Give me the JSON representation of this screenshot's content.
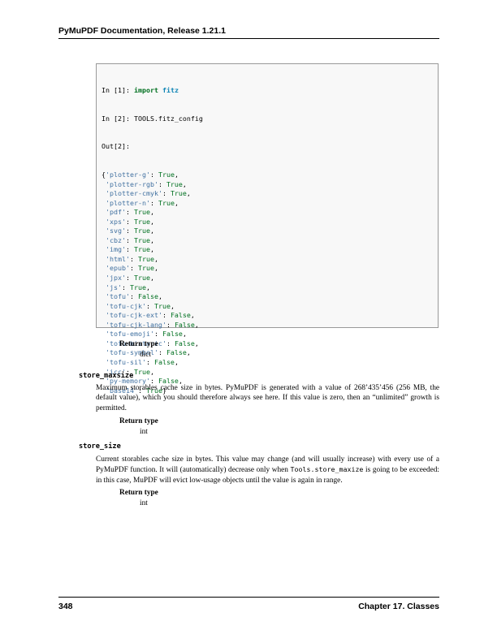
{
  "header": {
    "title": "PyMuPDF Documentation, Release 1.21.1"
  },
  "code": {
    "line1_prompt": "In [1]: ",
    "line1_kw": "import",
    "line1_space": " ",
    "line1_mod": "fitz",
    "line2": "In [2]: TOOLS.fitz_config",
    "line3": "Out[2]:",
    "entries": [
      {
        "key": "'plotter-g'",
        "value": "True"
      },
      {
        "key": "'plotter-rgb'",
        "value": "True"
      },
      {
        "key": "'plotter-cmyk'",
        "value": "True"
      },
      {
        "key": "'plotter-n'",
        "value": "True"
      },
      {
        "key": "'pdf'",
        "value": "True"
      },
      {
        "key": "'xps'",
        "value": "True"
      },
      {
        "key": "'svg'",
        "value": "True"
      },
      {
        "key": "'cbz'",
        "value": "True"
      },
      {
        "key": "'img'",
        "value": "True"
      },
      {
        "key": "'html'",
        "value": "True"
      },
      {
        "key": "'epub'",
        "value": "True"
      },
      {
        "key": "'jpx'",
        "value": "True"
      },
      {
        "key": "'js'",
        "value": "True"
      },
      {
        "key": "'tofu'",
        "value": "False"
      },
      {
        "key": "'tofu-cjk'",
        "value": "True"
      },
      {
        "key": "'tofu-cjk-ext'",
        "value": "False"
      },
      {
        "key": "'tofu-cjk-lang'",
        "value": "False"
      },
      {
        "key": "'tofu-emoji'",
        "value": "False"
      },
      {
        "key": "'tofu-historic'",
        "value": "False"
      },
      {
        "key": "'tofu-symbol'",
        "value": "False"
      },
      {
        "key": "'tofu-sil'",
        "value": "False"
      },
      {
        "key": "'icc'",
        "value": "True"
      },
      {
        "key": "'py-memory'",
        "value": "False"
      },
      {
        "key": "'base14'",
        "value": "True"
      }
    ]
  },
  "return1": {
    "label": "Return type",
    "value": "dict"
  },
  "store_maxsize": {
    "name": "store_maxsize",
    "description": "Maximum storables cache size in bytes. PyMuPDF is generated with a value of 268’435’456 (256 MB, the default value), which you should therefore always see here. If this value is zero, then an “unlimited” growth is permitted.",
    "return_label": "Return type",
    "return_value": "int"
  },
  "store_size": {
    "name": "store_size",
    "desc_part1": "Current storables cache size in bytes. This value may change (and will usually increase) with every use of a PyMuPDF function. It will (automatically) decrease only when ",
    "desc_code": "Tools.store_maxize",
    "desc_part2": " is going to be exceeded: in this case, MuPDF will evict low-usage objects until the value is again in range.",
    "return_label": "Return type",
    "return_value": "int"
  },
  "footer": {
    "page_number": "348",
    "chapter": "Chapter 17.  Classes"
  }
}
